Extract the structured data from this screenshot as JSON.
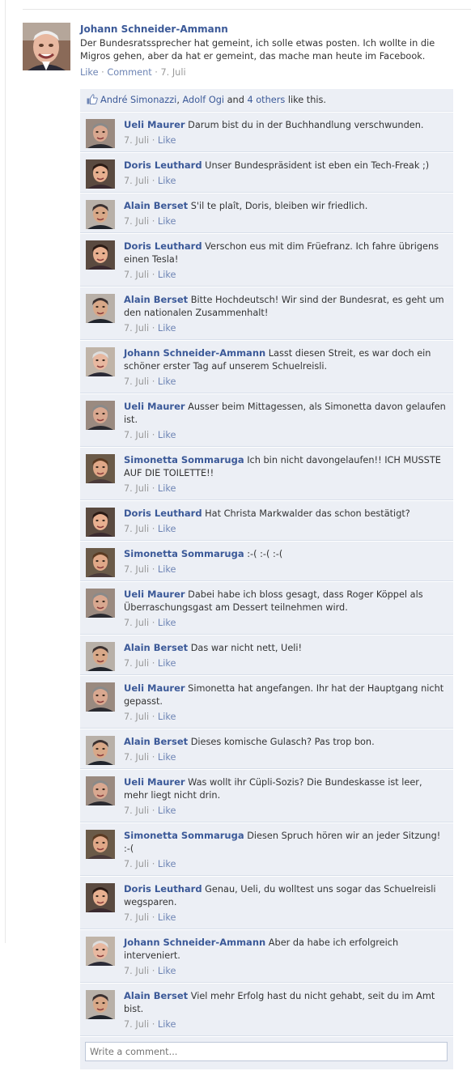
{
  "post": {
    "author": "Johann Schneider-Ammann",
    "text": "Der Bundesratssprecher hat gemeint, ich solle etwas posten. Ich wollte in die Migros gehen, aber da hat er gemeint, das mache man heute im Facebook.",
    "like_label": "Like",
    "separator": "·",
    "comment_label": "Comment",
    "time": "7. Juli"
  },
  "likes": {
    "names_1": "André Simonazzi",
    "comma": ", ",
    "names_2": "Adolf Ogi",
    "and_text": " and ",
    "others": "4 others",
    "suffix": " like this."
  },
  "comment_meta": {
    "separator": "·",
    "like_label": "Like"
  },
  "comments": [
    {
      "author": "Ueli Maurer",
      "text": "Darum bist du in der Buchhandlung verschwunden.",
      "time": "7. Juli",
      "avatar": "maurer"
    },
    {
      "author": "Doris Leuthard",
      "text": "Unser Bundespräsident ist eben ein Tech-Freak ;)",
      "time": "7. Juli",
      "avatar": "leuthard"
    },
    {
      "author": "Alain Berset",
      "text": "S'il te plaît, Doris, bleiben wir friedlich.",
      "time": "7. Juli",
      "avatar": "berset"
    },
    {
      "author": "Doris Leuthard",
      "text": "Verschon eus mit dim Früefranz. Ich fahre übrigens einen Tesla!",
      "time": "7. Juli",
      "avatar": "leuthard"
    },
    {
      "author": "Alain Berset",
      "text": "Bitte Hochdeutsch! Wir sind der Bundesrat, es geht um den nationalen Zusammenhalt!",
      "time": "7. Juli",
      "avatar": "berset"
    },
    {
      "author": "Johann Schneider-Ammann",
      "text": "Lasst diesen Streit, es war doch ein schöner erster Tag auf unserem Schuelreisli.",
      "time": "7. Juli",
      "avatar": "ammann"
    },
    {
      "author": "Ueli Maurer",
      "text": "Ausser beim Mittagessen, als Simonetta davon gelaufen ist.",
      "time": "7. Juli",
      "avatar": "maurer"
    },
    {
      "author": "Simonetta Sommaruga",
      "text": "Ich bin nicht davongelaufen!! ICH MUSSTE AUF DIE TOILETTE!!",
      "time": "7. Juli",
      "avatar": "sommaruga"
    },
    {
      "author": "Doris Leuthard",
      "text": "Hat Christa Markwalder das schon bestätigt?",
      "time": "7. Juli",
      "avatar": "leuthard"
    },
    {
      "author": "Simonetta Sommaruga",
      "text": ":-( :-( :-(",
      "time": "7. Juli",
      "avatar": "sommaruga"
    },
    {
      "author": "Ueli Maurer",
      "text": "Dabei habe ich bloss gesagt, dass Roger Köppel als Überraschungsgast am Dessert teilnehmen wird.",
      "time": "7. Juli",
      "avatar": "maurer"
    },
    {
      "author": "Alain Berset",
      "text": "Das war nicht nett, Ueli!",
      "time": "7. Juli",
      "avatar": "berset"
    },
    {
      "author": "Ueli Maurer",
      "text": "Simonetta hat angefangen. Ihr hat der Hauptgang nicht gepasst.",
      "time": "7. Juli",
      "avatar": "maurer"
    },
    {
      "author": "Alain Berset",
      "text": "Dieses komische Gulasch? Pas trop bon.",
      "time": "7. Juli",
      "avatar": "berset"
    },
    {
      "author": "Ueli Maurer",
      "text": "Was wollt ihr Cüpli-Sozis? Die Bundeskasse ist leer, mehr liegt nicht drin.",
      "time": "7. Juli",
      "avatar": "maurer"
    },
    {
      "author": "Simonetta Sommaruga",
      "text": "Diesen Spruch hören wir an jeder Sitzung! :-(",
      "time": "7. Juli",
      "avatar": "sommaruga"
    },
    {
      "author": "Doris Leuthard",
      "text": "Genau, Ueli, du wolltest uns sogar das Schuelreisli wegsparen.",
      "time": "7. Juli",
      "avatar": "leuthard"
    },
    {
      "author": "Johann Schneider-Ammann",
      "text": "Aber da habe ich erfolgreich interveniert.",
      "time": "7. Juli",
      "avatar": "ammann"
    },
    {
      "author": "Alain Berset",
      "text": "Viel mehr Erfolg hast du nicht gehabt, seit du im Amt bist.",
      "time": "7. Juli",
      "avatar": "berset"
    }
  ],
  "comment_input": {
    "placeholder": "Write a comment..."
  },
  "colors": {
    "link": "#3b5998",
    "thread_bg": "#eceff5",
    "meta": "#999999"
  }
}
